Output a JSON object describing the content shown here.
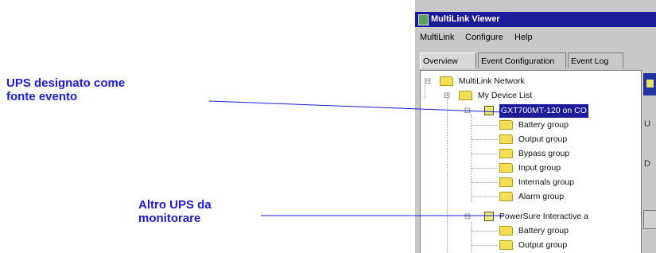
{
  "callouts": [
    {
      "lines": [
        "UPS designato come",
        "fonte evento"
      ]
    },
    {
      "lines": [
        "Altro UPS da",
        "monitorare"
      ]
    }
  ],
  "colors": {
    "callout_text": "#1a1adc",
    "leader_line": "#1a1adc",
    "titlebar": "#1c1c98",
    "selection": "#1c1c98",
    "folder": "#f3df55"
  },
  "window": {
    "title": "MultiLink Viewer",
    "menu": [
      "MultiLink",
      "Configure",
      "Help"
    ],
    "tabs": [
      "Overview",
      "Event Configuration",
      "Event Log"
    ],
    "active_tab": "Overview"
  },
  "tree": {
    "root": "MultiLink Network",
    "device_list": "My Device List",
    "device1": {
      "label": "GXT700MT-120 on CO",
      "selected": true,
      "icon": "ups-device-icon",
      "groups": [
        "Battery group",
        "Output group",
        "Bypass group",
        "Input group",
        "Internals group",
        "Alarm group"
      ]
    },
    "device2": {
      "label": "PowerSure Interactive a",
      "icon": "ups-device-icon",
      "groups": [
        "Battery group",
        "Output group"
      ]
    }
  },
  "side_panel": {
    "letters": [
      "U",
      "D"
    ]
  }
}
